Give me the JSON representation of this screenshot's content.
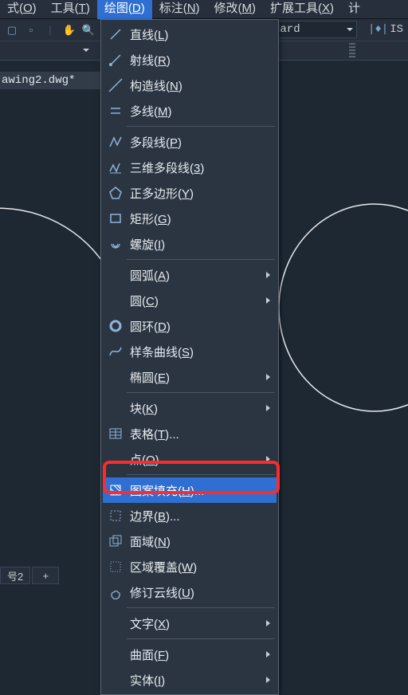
{
  "menubar": {
    "items": [
      {
        "pre": "式(",
        "u": "O",
        "post": ")"
      },
      {
        "pre": "工具(",
        "u": "T",
        "post": ")"
      },
      {
        "pre": "绘图(",
        "u": "D",
        "post": ")"
      },
      {
        "pre": "标注(",
        "u": "N",
        "post": ")"
      },
      {
        "pre": "修改(",
        "u": "M",
        "post": ")"
      },
      {
        "pre": "扩展工具(",
        "u": "X",
        "post": ")"
      },
      {
        "pre": "计",
        "u": "",
        "post": ""
      }
    ],
    "active_index": 2
  },
  "toolbar2": {
    "style_combo": "dard",
    "is_label": "IS"
  },
  "doc_tab": "awing2.dwg*",
  "dropdown": {
    "items": [
      {
        "kind": "item",
        "icon": "line-icon",
        "pre": "直线(",
        "u": "L",
        "post": ")",
        "sub": false
      },
      {
        "kind": "item",
        "icon": "ray-icon",
        "pre": "射线(",
        "u": "R",
        "post": ")",
        "sub": false
      },
      {
        "kind": "item",
        "icon": "xline-icon",
        "pre": "构造线(",
        "u": "N",
        "post": ")",
        "sub": false
      },
      {
        "kind": "item",
        "icon": "mline-icon",
        "pre": "多线(",
        "u": "M",
        "post": ")",
        "sub": false
      },
      {
        "kind": "sep"
      },
      {
        "kind": "item",
        "icon": "pline-icon",
        "pre": "多段线(",
        "u": "P",
        "post": ")",
        "sub": false
      },
      {
        "kind": "item",
        "icon": "pline3d-icon",
        "pre": "三维多段线(",
        "u": "3",
        "post": ")",
        "sub": false
      },
      {
        "kind": "item",
        "icon": "polygon-icon",
        "pre": "正多边形(",
        "u": "Y",
        "post": ")",
        "sub": false
      },
      {
        "kind": "item",
        "icon": "rect-icon",
        "pre": "矩形(",
        "u": "G",
        "post": ")",
        "sub": false
      },
      {
        "kind": "item",
        "icon": "spiral-icon",
        "pre": "螺旋(",
        "u": "I",
        "post": ")",
        "sub": false
      },
      {
        "kind": "sep"
      },
      {
        "kind": "item",
        "icon": "",
        "pre": "圆弧(",
        "u": "A",
        "post": ")",
        "sub": true
      },
      {
        "kind": "item",
        "icon": "",
        "pre": "圆(",
        "u": "C",
        "post": ")",
        "sub": true
      },
      {
        "kind": "item",
        "icon": "donut-icon",
        "pre": "圆环(",
        "u": "D",
        "post": ")",
        "sub": false
      },
      {
        "kind": "item",
        "icon": "spline-icon",
        "pre": "样条曲线(",
        "u": "S",
        "post": ")",
        "sub": false
      },
      {
        "kind": "item",
        "icon": "",
        "pre": "椭圆(",
        "u": "E",
        "post": ")",
        "sub": true
      },
      {
        "kind": "sep"
      },
      {
        "kind": "item",
        "icon": "",
        "pre": "块(",
        "u": "K",
        "post": ")",
        "sub": true
      },
      {
        "kind": "item",
        "icon": "table-icon",
        "pre": "表格(",
        "u": "T",
        "post": ")...",
        "sub": false
      },
      {
        "kind": "item",
        "icon": "",
        "pre": "点(",
        "u": "O",
        "post": ")",
        "sub": true
      },
      {
        "kind": "sep"
      },
      {
        "kind": "item",
        "icon": "hatch-icon",
        "pre": "图案填充(",
        "u": "H",
        "post": ")...",
        "sub": false,
        "hl": true
      },
      {
        "kind": "item",
        "icon": "boundary-icon",
        "pre": "边界(",
        "u": "B",
        "post": ")...",
        "sub": false
      },
      {
        "kind": "item",
        "icon": "region-icon",
        "pre": "面域(",
        "u": "N",
        "post": ")",
        "sub": false
      },
      {
        "kind": "item",
        "icon": "wipeout-icon",
        "pre": "区域覆盖(",
        "u": "W",
        "post": ")",
        "sub": false
      },
      {
        "kind": "item",
        "icon": "revcloud-icon",
        "pre": "修订云线(",
        "u": "U",
        "post": ")",
        "sub": false
      },
      {
        "kind": "sep"
      },
      {
        "kind": "item",
        "icon": "",
        "pre": "文字(",
        "u": "X",
        "post": ")",
        "sub": true
      },
      {
        "kind": "sep"
      },
      {
        "kind": "item",
        "icon": "",
        "pre": "曲面(",
        "u": "F",
        "post": ")",
        "sub": true
      },
      {
        "kind": "item",
        "icon": "",
        "pre": "实体(",
        "u": "I",
        "post": ")",
        "sub": true
      }
    ]
  },
  "bottom_tabs": {
    "tab2_label": "号2",
    "plus_label": "+"
  },
  "colors": {
    "accent": "#2f6fd1",
    "callout": "#ff2a2a",
    "panel_bg": "#2b3542",
    "app_bg": "#1e2833"
  }
}
